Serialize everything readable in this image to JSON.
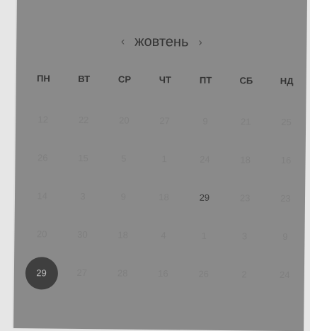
{
  "calendar": {
    "prev_icon": "‹",
    "month": "жовтень",
    "next_icon": "›",
    "weekdays": [
      "ПН",
      "ВТ",
      "СР",
      "ЧТ",
      "ПТ",
      "СБ",
      "НД"
    ],
    "weeks": [
      [
        "12",
        "22",
        "20",
        "27",
        "9",
        "21",
        "25"
      ],
      [
        "26",
        "15",
        "5",
        "1",
        "24",
        "18",
        "16"
      ],
      [
        "14",
        "3",
        "9",
        "18",
        "29",
        "23",
        "23"
      ],
      [
        "20",
        "30",
        "18",
        "4",
        "1",
        "3",
        "9"
      ],
      [
        "29",
        "27",
        "28",
        "16",
        "26",
        "2",
        "24"
      ]
    ]
  },
  "colors": {
    "panel": "#8a8a8a",
    "background": "#e6e6e6",
    "selected_circle": "#3f3f3f"
  }
}
